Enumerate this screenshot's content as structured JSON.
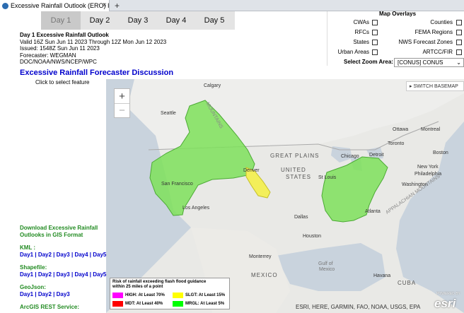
{
  "browser": {
    "tab_title": "Excessive Rainfall Outlook (ERO) Intera",
    "close_glyph": "×",
    "new_tab_glyph": "+"
  },
  "day_tabs": [
    "Day 1",
    "Day 2",
    "Day 3",
    "Day 4",
    "Day 5"
  ],
  "outlook": {
    "title": "Day 1 Excessive Rainfall Outlook",
    "valid": "Valid 16Z Sun Jun 11 2023 Through 12Z Mon Jun 12 2023",
    "issued": "Issued: 1548Z Sun Jun 11 2023",
    "forecaster": "Forecaster: WEGMAN",
    "office": "DOC/NOAA/NWS/NCEP/WPC"
  },
  "discussion_link": "Excessive Rainfall Forecaster Discussion",
  "click_hint": "Click to select feature",
  "overlays": {
    "title": "Map Overlays",
    "left": [
      "CWAs",
      "RFCs",
      "States",
      "Urban Areas"
    ],
    "right": [
      "Counties",
      "FEMA Regions",
      "NWS Forecast Zones",
      "ARTCC/FIR"
    ]
  },
  "zoom_area": {
    "label": "Select Zoom Area:",
    "value": "[CONUS] CONUS"
  },
  "downloads": {
    "title_line1": "Download Excessive Rainfall",
    "title_line2": "Outlooks in GIS Format",
    "kml_label": "KML :",
    "kml_links": [
      "Day1",
      "Day2",
      "Day3",
      "Day4",
      "Day5"
    ],
    "shapefile_label": "Shapefile:",
    "shapefile_links": [
      "Day1",
      "Day2",
      "Day3",
      "Day4",
      "Day5"
    ],
    "geojson_label": "GeoJson:",
    "geojson_links": [
      "Day1",
      "Day2",
      "Day3"
    ],
    "arcgis_label": "ArcGIS REST Service:"
  },
  "map": {
    "zoom_in": "+",
    "zoom_out": "−",
    "switch_basemap": "▸ SWITCH BASEMAP",
    "attribution": "ESRI, HERE, GARMIN, FAO, NOAA, USGS, EPA",
    "esri_logo": "esri",
    "powered_by": "POWERED BY",
    "labels": {
      "calgary": "Calgary",
      "seattle": "Seattle",
      "great_plains": "GREAT PLAINS",
      "united_states_1": "UNITED",
      "united_states_2": "STATES",
      "denver": "Denver",
      "san_francisco": "San Francisco",
      "los_angeles": "Los Angeles",
      "dallas": "Dallas",
      "houston": "Houston",
      "st_louis": "St Louis",
      "chicago": "Chicago",
      "detroit": "Detroit",
      "ottawa": "Ottawa",
      "montreal": "Montreal",
      "toronto": "Toronto",
      "boston": "Boston",
      "new_york": "New York",
      "philadelphia": "Philadelphia",
      "washington": "Washington",
      "atlanta": "Atlanta",
      "mexico": "MEXICO",
      "monterrey": "Monterrey",
      "havana": "Havana",
      "cuba": "CUBA",
      "gulf_1": "Gulf of",
      "gulf_2": "Mexico",
      "appalachian": "APPALACHIAN MOUNTAINS",
      "rocky": "MOUNTAINS"
    }
  },
  "legend": {
    "title_line1": "Risk of rainfall exceeding flash flood guidance",
    "title_line2": "within 25 miles of a point",
    "items": [
      {
        "label": "HIGH: At Least 70%",
        "color": "#ff00ff"
      },
      {
        "label": "SLGT: At Least 15%",
        "color": "#ffff00"
      },
      {
        "label": "MDT: At Least 40%",
        "color": "#ff0000"
      },
      {
        "label": "MRGL: At Least 5%",
        "color": "#00ff00"
      }
    ]
  },
  "colors": {
    "marginal_fill": "#7ee05a",
    "slight_fill": "#f3ef5a",
    "link_blue": "#0000cc",
    "gis_green": "#228b22"
  }
}
